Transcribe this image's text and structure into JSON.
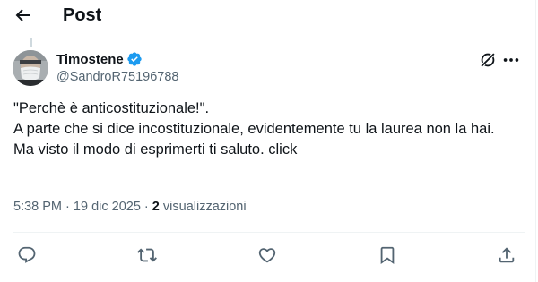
{
  "header": {
    "title": "Post",
    "back_icon": "arrow-left-icon"
  },
  "author": {
    "display_name": "Timostene",
    "verified": true,
    "verified_color": "#1d9bf0",
    "handle": "@SandroR75196788"
  },
  "tweet": {
    "lines": [
      "\"Perchè è anticostituzionale!\".",
      "A parte che si dice incostituzionale, evidentemente tu la laurea non la hai.",
      "Ma visto il modo di esprimerti ti saluto. click"
    ]
  },
  "meta": {
    "time": "5:38 PM",
    "separator": "·",
    "date": "19 dic 2025",
    "views_count": "2",
    "views_label": "visualizzazioni"
  },
  "actions": {
    "icons": [
      "reply-icon",
      "retweet-icon",
      "like-icon",
      "bookmark-icon",
      "share-icon"
    ],
    "top_icons": [
      "grok-icon",
      "more-icon"
    ]
  },
  "colors": {
    "text": "#0f1419",
    "secondary": "#536471",
    "divider": "#eff3f4",
    "accent": "#1d9bf0"
  }
}
